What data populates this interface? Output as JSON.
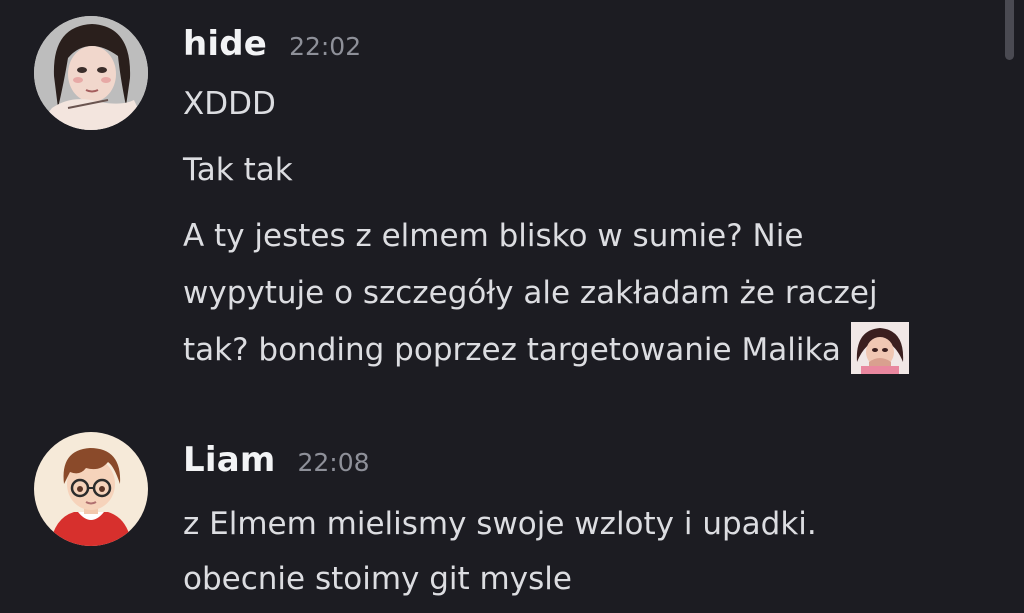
{
  "messages": [
    {
      "author": "hide",
      "time": "22:02",
      "lines": [
        "XDDD",
        "Tak tak",
        "A ty jestes z elmem blisko w sumie? Nie",
        "wypytuje o szczegóły ale zakładam że raczej",
        "tak? bonding poprzez targetowanie Malika"
      ],
      "emoji": "custom-emoji-crying-woman"
    },
    {
      "author": "Liam",
      "time": "22:08",
      "lines": [
        "z Elmem mielismy swoje wzloty i upadki.",
        "obecnie stoimy git mysle"
      ]
    }
  ],
  "colors": {
    "background": "#1c1c22",
    "username": "#f2f3f5",
    "timestamp": "#8e9099",
    "text": "#dcdde1"
  }
}
